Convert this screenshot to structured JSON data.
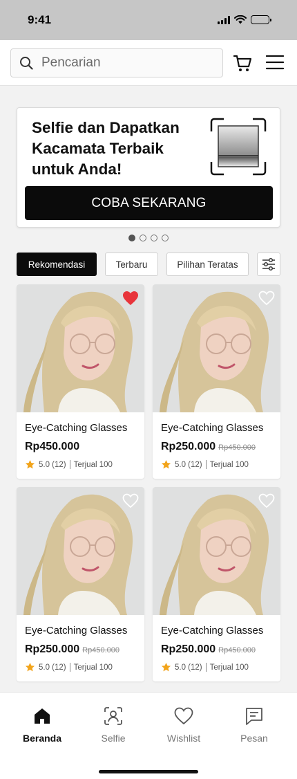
{
  "status_bar": {
    "time": "9:41"
  },
  "header": {
    "search_placeholder": "Pencarian"
  },
  "banner": {
    "title": "Selfie dan Dapatkan Kacamata Terbaik untuk Anda!",
    "cta_label": "COBA SEKARANG",
    "carousel_pages": 4,
    "carousel_active": 1
  },
  "filters": {
    "chips": [
      {
        "label": "Rekomendasi",
        "active": true
      },
      {
        "label": "Terbaru",
        "active": false
      },
      {
        "label": "Pilihan Teratas",
        "active": false
      }
    ],
    "filter_icon": "sliders-icon"
  },
  "products": [
    {
      "name": "Eye-Catching Glasses",
      "price": "Rp450.000",
      "old_price": "",
      "rating": "5.0 (12)",
      "sold": "Terjual 100",
      "wishlisted": true
    },
    {
      "name": "Eye-Catching Glasses",
      "price": "Rp250.000",
      "old_price": "Rp450.000",
      "rating": "5.0 (12)",
      "sold": "Terjual 100",
      "wishlisted": false
    },
    {
      "name": "Eye-Catching Glasses",
      "price": "Rp250.000",
      "old_price": "Rp450.000",
      "rating": "5.0 (12)",
      "sold": "Terjual 100",
      "wishlisted": false
    },
    {
      "name": "Eye-Catching Glasses",
      "price": "Rp250.000",
      "old_price": "Rp450.000",
      "rating": "5.0 (12)",
      "sold": "Terjual 100",
      "wishlisted": false
    }
  ],
  "tabbar": {
    "items": [
      {
        "label": "Beranda",
        "icon": "home-icon",
        "active": true
      },
      {
        "label": "Selfie",
        "icon": "face-scan-icon",
        "active": false
      },
      {
        "label": "Wishlist",
        "icon": "heart-icon",
        "active": false
      },
      {
        "label": "Pesan",
        "icon": "message-icon",
        "active": false
      }
    ]
  },
  "colors": {
    "primary": "#0b0b0b",
    "wishlist_active": "#e8353b",
    "star": "#f2a41b",
    "status_bar_bg": "#c6c6c6"
  }
}
